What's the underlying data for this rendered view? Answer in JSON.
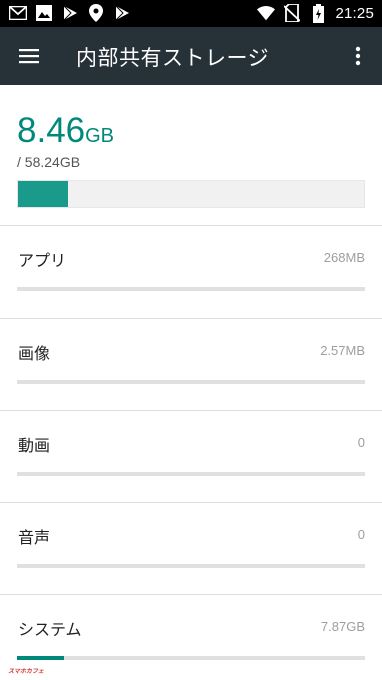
{
  "status_bar": {
    "time": "21:25",
    "left_icons": [
      "gmail-icon",
      "image-icon",
      "play-store-icon",
      "location-icon",
      "play-store-icon"
    ],
    "right_icons": [
      "wifi-icon",
      "no-sim-icon",
      "battery-icon"
    ]
  },
  "app_bar": {
    "title": "内部共有ストレージ",
    "menu_icon": "hamburger-menu-icon",
    "more_icon": "more-vert-icon",
    "background": "#263238"
  },
  "summary": {
    "used_value": "8.46",
    "used_unit": "GB",
    "total": "/ 58.24GB",
    "used_fraction": 0.145,
    "accent": "#00897b"
  },
  "categories": [
    {
      "label": "アプリ",
      "size": "268MB",
      "fraction": 0.0
    },
    {
      "label": "画像",
      "size": "2.57MB",
      "fraction": 0.0
    },
    {
      "label": "動画",
      "size": "0",
      "fraction": 0.0
    },
    {
      "label": "音声",
      "size": "0",
      "fraction": 0.0
    },
    {
      "label": "システム",
      "size": "7.87GB",
      "fraction": 0.135
    }
  ],
  "watermark": "スマホカフェ"
}
